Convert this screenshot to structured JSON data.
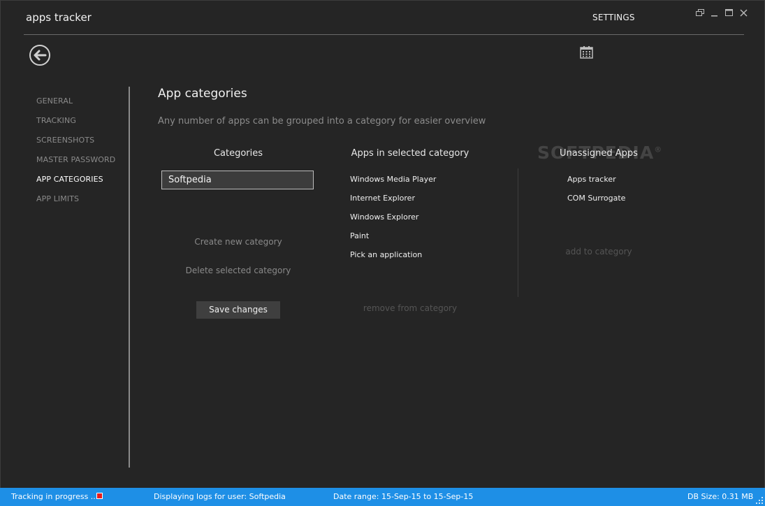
{
  "window": {
    "title": "apps tracker",
    "settings_label": "SETTINGS",
    "controls": [
      "restore-icon",
      "minimize-icon",
      "maximize-icon",
      "close-icon"
    ]
  },
  "nav": {
    "items": [
      {
        "label": "GENERAL",
        "active": false
      },
      {
        "label": "TRACKING",
        "active": false
      },
      {
        "label": "SCREENSHOTS",
        "active": false
      },
      {
        "label": "MASTER PASSWORD",
        "active": false
      },
      {
        "label": "APP CATEGORIES",
        "active": true
      },
      {
        "label": "APP LIMITS",
        "active": false
      }
    ]
  },
  "main": {
    "title": "App categories",
    "subtitle": "Any number of apps can be grouped into a category for easier overview",
    "categories": {
      "header": "Categories",
      "selected": "Softpedia",
      "create_label": "Create new category",
      "delete_label": "Delete selected category",
      "save_label": "Save changes"
    },
    "apps_in_category": {
      "header": "Apps in selected category",
      "items": [
        "Windows Media Player",
        "Internet Explorer",
        "Windows Explorer",
        "Paint",
        "Pick an application"
      ],
      "remove_label": "remove from category"
    },
    "unassigned": {
      "header": "Unassigned Apps",
      "items": [
        "Apps tracker",
        "COM Surrogate"
      ],
      "add_label": "add to category"
    }
  },
  "watermark": "SOFTPEDIA",
  "status": {
    "tracking": "Tracking in progress ...",
    "user": "Displaying logs for user: Softpedia",
    "date_range": "Date range: 15-Sep-15 to 15-Sep-15",
    "db_size": "DB Size: 0.31 MB"
  },
  "colors": {
    "background": "#252525",
    "status_bar": "#1e8fe6",
    "record_indicator": "#e81d1d",
    "muted_text": "#8a8a8a"
  }
}
